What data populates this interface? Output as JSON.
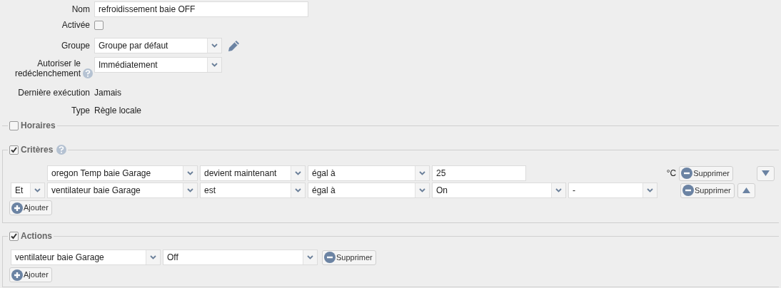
{
  "fields": [
    {
      "kind": "text",
      "label": "Nom",
      "value": "refroidissement baie OFF"
    },
    {
      "kind": "checkbox",
      "label": "Activée",
      "checked": false
    },
    {
      "kind": "select",
      "label": "Groupe",
      "value": "Groupe par défaut",
      "editable": true
    },
    {
      "kind": "select",
      "label": "Autoriser le redéclenchement",
      "value": "Immédiatement",
      "help": true
    },
    {
      "kind": "info",
      "label": "Dernière exécution",
      "value": "Jamais"
    },
    {
      "kind": "info",
      "label": "Type",
      "value": "Règle locale"
    }
  ],
  "sections": [
    {
      "title": "Horaires",
      "checked": false
    },
    {
      "kind": "criteria",
      "title": "Critères",
      "checked": true,
      "help": true,
      "add_button": "Ajouter",
      "rows": [
        {
          "conjunction": null,
          "fields": [
            {
              "kind": "select",
              "value": "oregon Temp baie Garage"
            },
            {
              "kind": "select",
              "value": "devient maintenant"
            },
            {
              "kind": "select",
              "value": "égal à"
            },
            {
              "kind": "input",
              "value": "25"
            }
          ],
          "unit": "°C",
          "delete": "Supprimer",
          "move_up": false,
          "move_down": true
        },
        {
          "conjunction": "Et",
          "fields": [
            {
              "kind": "select",
              "value": "ventilateur baie Garage"
            },
            {
              "kind": "select",
              "value": "est"
            },
            {
              "kind": "select",
              "value": "égal à"
            },
            {
              "kind": "select",
              "value": "On"
            },
            {
              "kind": "select",
              "value": "-"
            }
          ],
          "unit": null,
          "delete": "Supprimer",
          "move_up": true,
          "move_down": false
        }
      ]
    },
    {
      "kind": "actions",
      "title": "Actions",
      "checked": true,
      "add_button": "Ajouter",
      "rows": [
        {
          "fields": [
            {
              "kind": "select",
              "value": "ventilateur baie Garage"
            },
            {
              "kind": "select",
              "value": "Off"
            }
          ],
          "delete": "Supprimer"
        }
      ]
    }
  ]
}
